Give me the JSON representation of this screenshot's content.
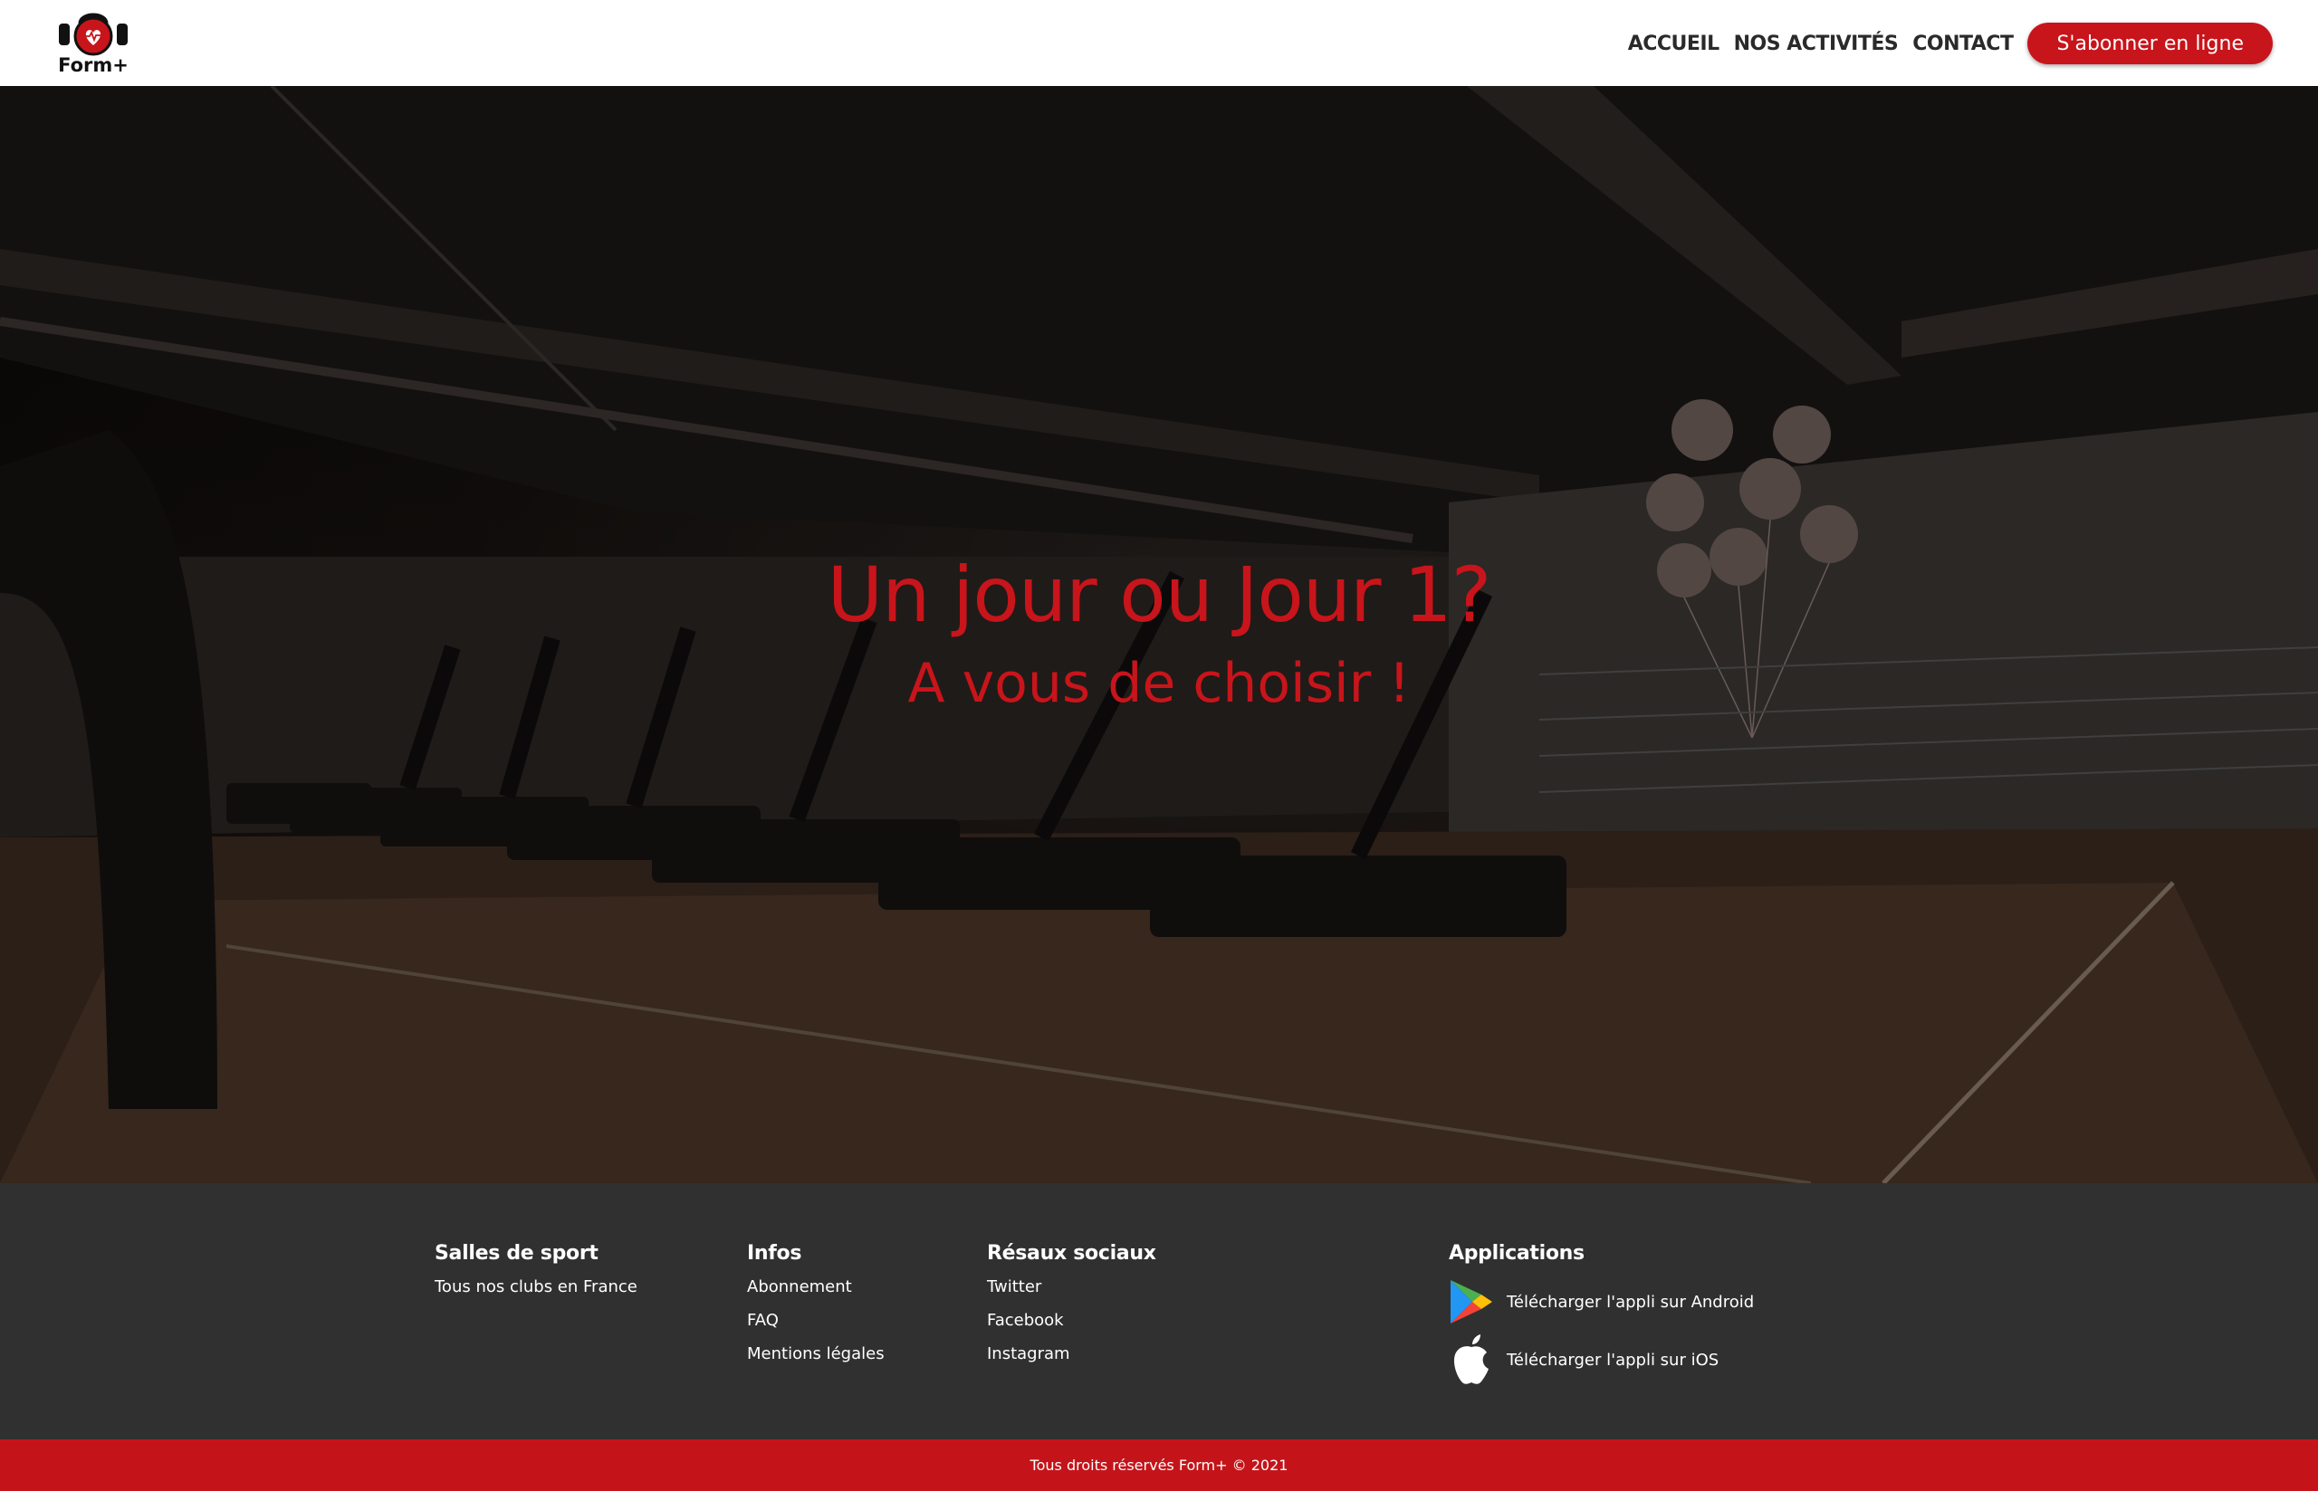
{
  "header": {
    "logo_text": "Form+",
    "nav": [
      {
        "label": "ACCUEIL"
      },
      {
        "label": "NOS ACTIVITÉS"
      },
      {
        "label": "CONTACT"
      }
    ],
    "cta_label": "S'abonner en ligne"
  },
  "hero": {
    "title": "Un jour ou Jour 1?",
    "subtitle": "A vous de choisir !"
  },
  "footer": {
    "columns": [
      {
        "title": "Salles de sport",
        "links": [
          "Tous nos clubs en France"
        ]
      },
      {
        "title": "Infos",
        "links": [
          "Abonnement",
          "FAQ",
          "Mentions légales"
        ]
      },
      {
        "title": "Résaux sociaux",
        "links": [
          "Twitter",
          "Facebook",
          "Instagram"
        ]
      }
    ],
    "apps": {
      "title": "Applications",
      "android": {
        "icon": "google-play-icon",
        "label": "Télécharger l'appli sur Android"
      },
      "ios": {
        "icon": "apple-icon",
        "label": "Télécharger l'appli sur iOS"
      }
    },
    "copyright": "Tous droits réservés Form+ © 2021"
  },
  "colors": {
    "accent": "#c8141b",
    "footer_bg": "#303030",
    "bottom_bar": "#c4141a"
  }
}
